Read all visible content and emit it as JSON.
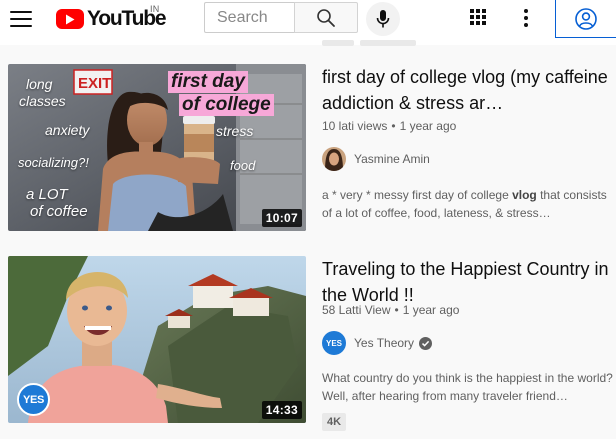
{
  "header": {
    "logo_text": "YouTube",
    "region": "IN",
    "search_placeholder": "Search",
    "icons": [
      "menu-icon",
      "search-icon",
      "mic-icon",
      "apps-icon",
      "more-vert-icon",
      "account-icon"
    ],
    "brand_color": "#ff0000",
    "accent_color": "#065fd4"
  },
  "videos": [
    {
      "title": "first day of college vlog (my caffeine addiction & stress ar…",
      "views": "10 lati views",
      "age": "1 year ago",
      "channel": "Yasmine Amin",
      "verified": false,
      "description_prefix": "a * very * messy first day of college ",
      "description_bold": "vlog",
      "description_suffix": " that consists of a lot of coffee, food, lateness, & stress…",
      "duration": "10:07",
      "thumbnail_text": {
        "label_line1": "first day",
        "label_line2": "of college",
        "word1": "long",
        "word2": "classes",
        "word3": "anxiety",
        "word4": "socializing?!",
        "word5": "stress",
        "word6": "food",
        "word7": "a LOT",
        "word8": "of coffee",
        "sign": "EXIT"
      }
    },
    {
      "title": "Traveling to the Happiest Country in the World !!",
      "views": "58 Latti View",
      "age": "1 year ago",
      "channel": "Yes Theory",
      "verified": true,
      "description": "What country do you think is the happiest in the world? Well, after hearing from many traveler friend…",
      "duration": "14:33",
      "badge": "4K",
      "thumbnail_logo_text": "YES",
      "avatar_text": "YES"
    }
  ]
}
